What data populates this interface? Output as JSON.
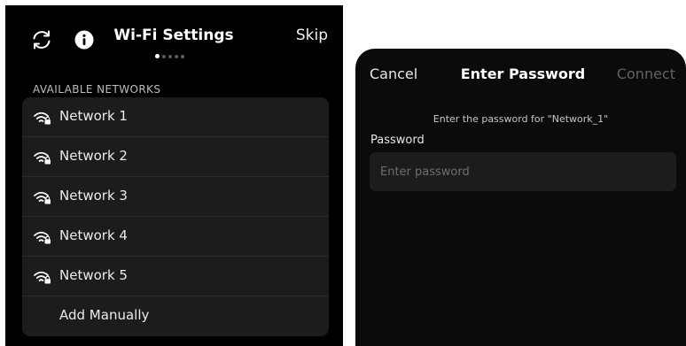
{
  "wifi_screen": {
    "title": "Wi-Fi Settings",
    "skip_label": "Skip",
    "page_indicator": {
      "total": 5,
      "active": 1
    },
    "section_title": "AVAILABLE NETWORKS",
    "networks": [
      {
        "label": "Network 1",
        "icon": "wifi-lock-icon"
      },
      {
        "label": "Network 2",
        "icon": "wifi-lock-icon"
      },
      {
        "label": "Network 3",
        "icon": "wifi-lock-icon"
      },
      {
        "label": "Network 4",
        "icon": "wifi-lock-icon"
      },
      {
        "label": "Network 5",
        "icon": "wifi-lock-icon"
      }
    ],
    "add_manually_label": "Add Manually",
    "header_icons": [
      "refresh-icon",
      "info-icon"
    ]
  },
  "password_dialog": {
    "cancel_label": "Cancel",
    "title": "Enter Password",
    "connect_label": "Connect",
    "prompt": "Enter the password for \"Network_1\"",
    "password_label": "Password",
    "password_value": "",
    "password_placeholder": "Enter password"
  },
  "colors": {
    "background": "#000000",
    "list_background": "#1c1c1e",
    "disabled_text": "#636366",
    "input_background": "#1c1c1e"
  }
}
